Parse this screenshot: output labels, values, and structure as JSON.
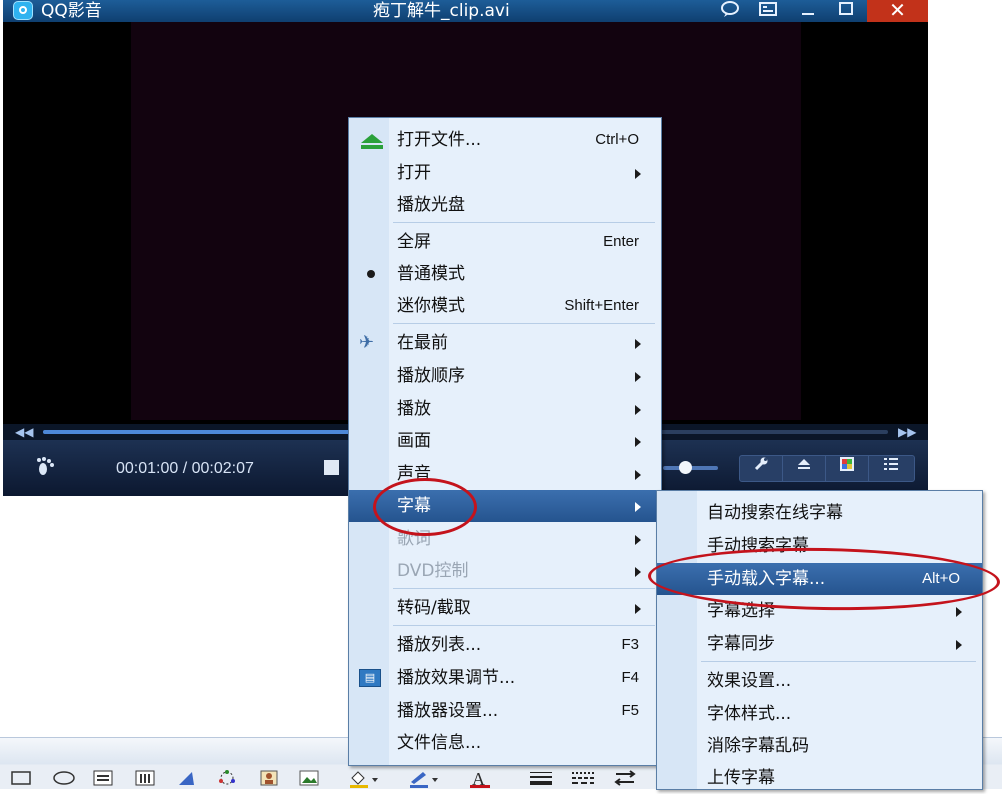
{
  "window": {
    "app_name": "QQ影音",
    "file_title": "疱丁解牛_clip.avi",
    "title_buttons": [
      "comment-icon",
      "list-window-icon",
      "minimize-icon",
      "maximize-icon",
      "close-icon"
    ],
    "close_glyph": "✕"
  },
  "player": {
    "time": "00:01:00 / 00:02:07",
    "progress": 0.47,
    "volume": 0.3,
    "control_icons": [
      "wrench-icon",
      "eject-icon",
      "color-icon",
      "playlist-icon"
    ]
  },
  "main_menu": {
    "items": [
      {
        "label": "打开文件...",
        "shortcut": "Ctrl+O",
        "icon": "eject-icon"
      },
      {
        "label": "打开",
        "submenu": true
      },
      {
        "label": "播放光盘"
      },
      {
        "label": "全屏",
        "shortcut": "Enter"
      },
      {
        "label": "普通模式",
        "icon": "bullet-icon"
      },
      {
        "label": "迷你模式",
        "shortcut": "Shift+Enter"
      },
      {
        "label": "在最前",
        "submenu": true,
        "icon": "pin-icon"
      },
      {
        "label": "播放顺序",
        "submenu": true
      },
      {
        "label": "播放",
        "submenu": true
      },
      {
        "label": "画面",
        "submenu": true
      },
      {
        "label": "声音",
        "submenu": true
      },
      {
        "label": "字幕",
        "submenu": true,
        "selected": true
      },
      {
        "label": "歌词",
        "submenu": true,
        "disabled": true
      },
      {
        "label": "DVD控制",
        "submenu": true,
        "disabled": true
      },
      {
        "label": "转码/截取",
        "submenu": true
      },
      {
        "label": "播放列表...",
        "shortcut": "F3"
      },
      {
        "label": "播放效果调节...",
        "shortcut": "F4",
        "icon": "equalizer-icon"
      },
      {
        "label": "播放器设置...",
        "shortcut": "F5"
      },
      {
        "label": "文件信息..."
      }
    ]
  },
  "subtitle_menu": {
    "items": [
      {
        "label": "自动搜索在线字幕"
      },
      {
        "label": "手动搜索字幕"
      },
      {
        "label": "手动载入字幕...",
        "shortcut": "Alt+O",
        "selected": true
      },
      {
        "label": "字幕选择",
        "submenu": true
      },
      {
        "label": "字幕同步",
        "submenu": true
      },
      {
        "label": "效果设置..."
      },
      {
        "label": "字体样式..."
      },
      {
        "label": "消除字幕乱码"
      },
      {
        "label": "上传字幕"
      }
    ]
  },
  "toolbar": {
    "tools": [
      "rectangle-icon",
      "ellipse-icon",
      "textbox-icon",
      "vertical-textbox-icon",
      "wordart-icon",
      "diagram-icon",
      "clipart-icon",
      "picture-icon",
      "fill-color-icon",
      "line-color-icon",
      "font-color-icon",
      "line-style-icon",
      "dash-style-icon",
      "arrow-style-icon"
    ],
    "font_color_glyph": "A"
  },
  "colors": {
    "title_bar": "#1d5d98",
    "menu_bg": "#e6f0fb",
    "menu_highlight": "#2d5f9e",
    "annotation": "#c4131c"
  }
}
